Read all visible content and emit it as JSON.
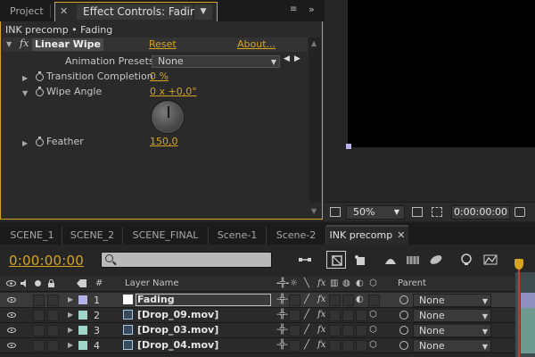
{
  "effect_controls": {
    "tab_project": "Project",
    "tab_title": "Effect Controls: Fading",
    "breadcrumb": "INK precomp • Fading",
    "effect_name": "Linear Wipe",
    "reset_label": "Reset",
    "about_label": "About...",
    "animation_presets_label": "Animation Presets:",
    "animation_presets_value": "None",
    "props": [
      {
        "label": "Transition Completion",
        "value": "0 %"
      },
      {
        "label": "Wipe Angle",
        "value": "0 x +0,0°"
      },
      {
        "label": "Feather",
        "value": "150,0"
      }
    ]
  },
  "viewer": {
    "zoom": "50%",
    "timecode": "0:00:00:00"
  },
  "comp_tabs": [
    {
      "label": "SCENE_1"
    },
    {
      "label": "SCENE_2"
    },
    {
      "label": "SCENE_FINAL"
    },
    {
      "label": "Scene-1"
    },
    {
      "label": "Scene-2"
    },
    {
      "label": "INK precomp"
    }
  ],
  "timeline": {
    "current_time": "0:00:00:00",
    "columns": {
      "num": "#",
      "layer_name": "Layer Name",
      "parent": "Parent"
    },
    "layers": [
      {
        "num": "1",
        "name": "Fading",
        "label_color": "#b3b3ea",
        "parent": "None"
      },
      {
        "num": "2",
        "name": "[Drop_09.mov]",
        "label_color": "#9fd6c9",
        "parent": "None"
      },
      {
        "num": "3",
        "name": "[Drop_03.mov]",
        "label_color": "#9fd6c9",
        "parent": "None"
      },
      {
        "num": "4",
        "name": "[Drop_04.mov]",
        "label_color": "#9fd6c9",
        "parent": "None"
      }
    ]
  },
  "colors": {
    "accent": "#d5a423",
    "playhead": "#c83a2a"
  }
}
